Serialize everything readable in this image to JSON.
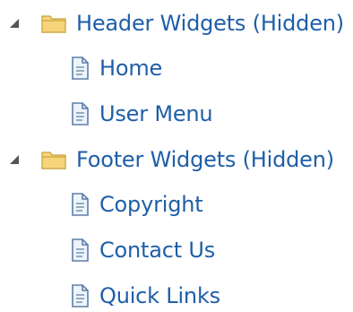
{
  "theme": {
    "label_color": "#1f5ea8",
    "folder_fill": "#f6d57a",
    "folder_stroke": "#c8a13a",
    "doc_fill": "#eef4fb",
    "doc_stroke": "#5d7fa8",
    "toggle_color": "#555555"
  },
  "tree": [
    {
      "label": "Header Widgets (Hidden)",
      "icon": "folder-icon",
      "expanded": true,
      "children": [
        {
          "label": "Home",
          "icon": "document-icon"
        },
        {
          "label": "User Menu",
          "icon": "document-icon"
        }
      ]
    },
    {
      "label": "Footer Widgets (Hidden)",
      "icon": "folder-icon",
      "expanded": true,
      "children": [
        {
          "label": "Copyright",
          "icon": "document-icon"
        },
        {
          "label": "Contact Us",
          "icon": "document-icon"
        },
        {
          "label": "Quick Links",
          "icon": "document-icon"
        }
      ]
    }
  ]
}
